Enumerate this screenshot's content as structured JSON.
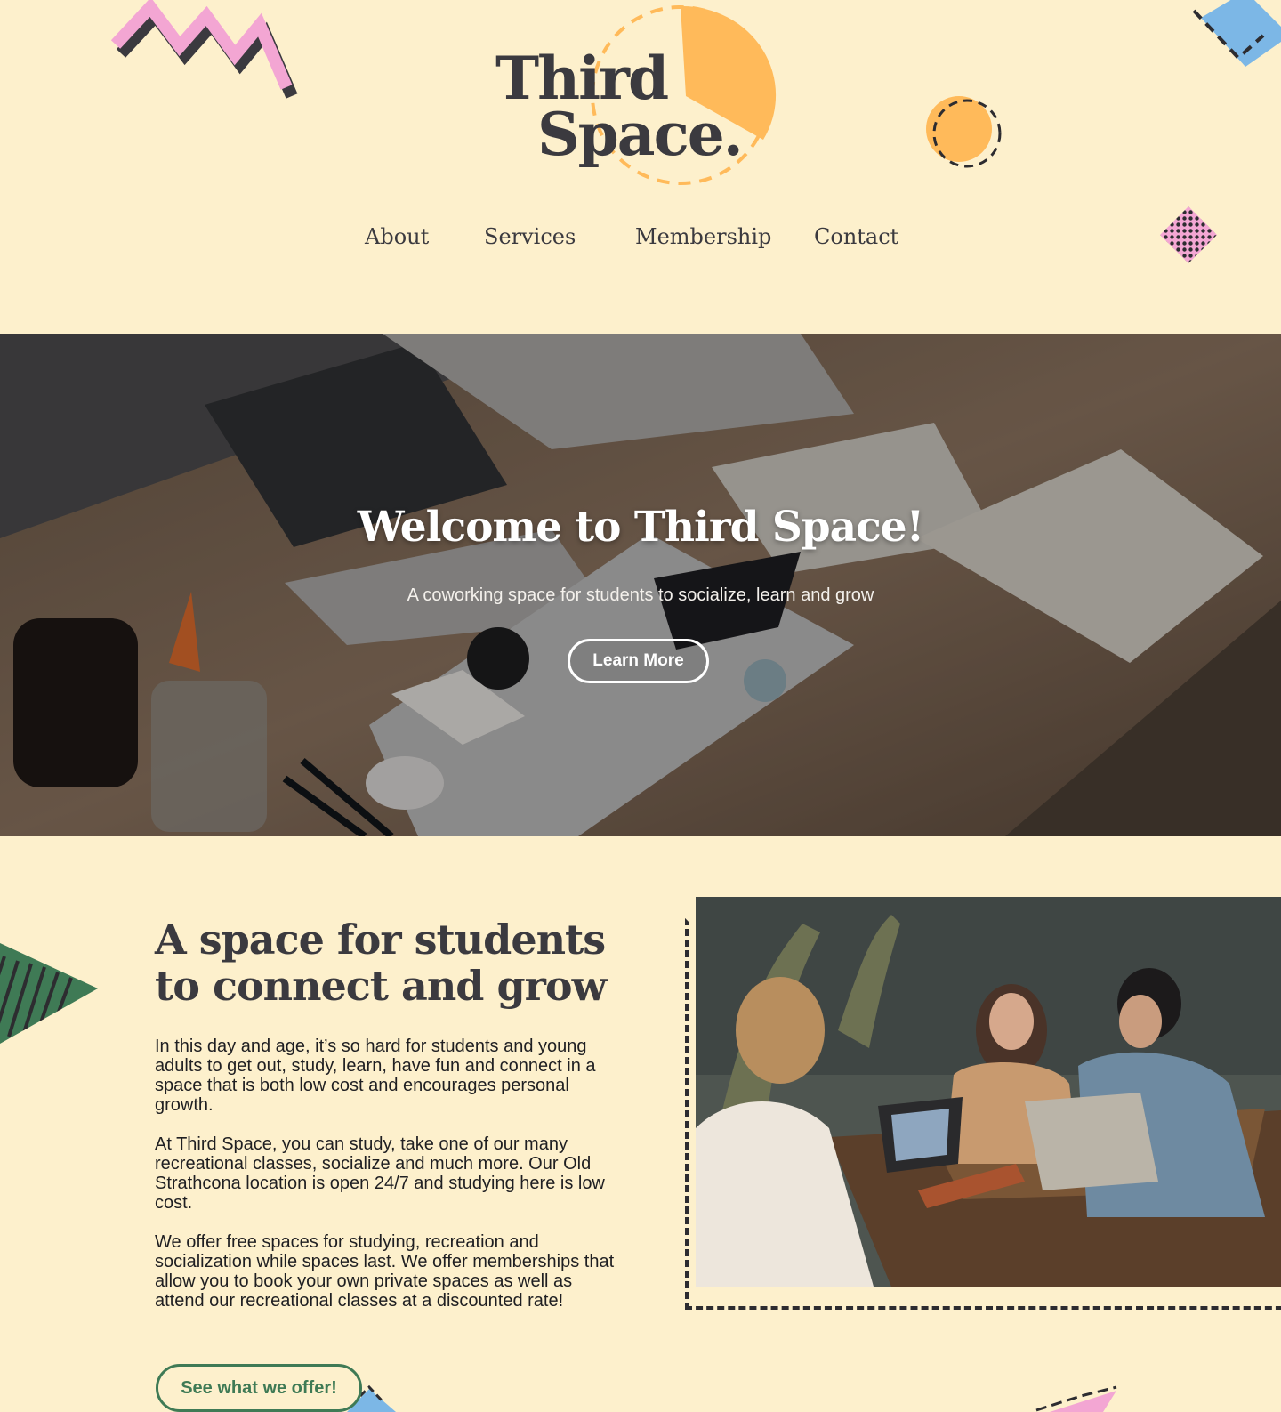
{
  "brand": {
    "line1": "Third",
    "line2": "Space."
  },
  "nav": {
    "items": [
      {
        "label": "About"
      },
      {
        "label": "Services"
      },
      {
        "label": "Membership"
      },
      {
        "label": "Contact"
      }
    ]
  },
  "hero": {
    "title": "Welcome to Third Space!",
    "subtitle": "A coworking space for students to socialize, learn and grow",
    "button_label": "Learn More"
  },
  "about": {
    "title": "A space for students to connect and grow",
    "paragraphs": [
      "In this day and age, it’s so hard for students and young adults to get out, study, learn, have fun and connect in a space that is both low cost and encourages personal growth.",
      "At Third Space, you can study, take one of our many recreational classes, socialize and much more. Our Old Strathcona location is open 24/7 and studying here is low cost.",
      "We offer free spaces for studying, recreation and socialization while spaces last. We offer memberships that allow you to book your own private spaces as well as attend our recreational classes at a discounted rate!"
    ],
    "button_label": "See what we offer!"
  },
  "colors": {
    "background": "#fdf0cc",
    "text": "#3b3a3f",
    "accent_orange": "#ffba5a",
    "accent_pink": "#f3a6d3",
    "accent_blue": "#7cb7e6",
    "accent_green": "#3f7a55"
  }
}
